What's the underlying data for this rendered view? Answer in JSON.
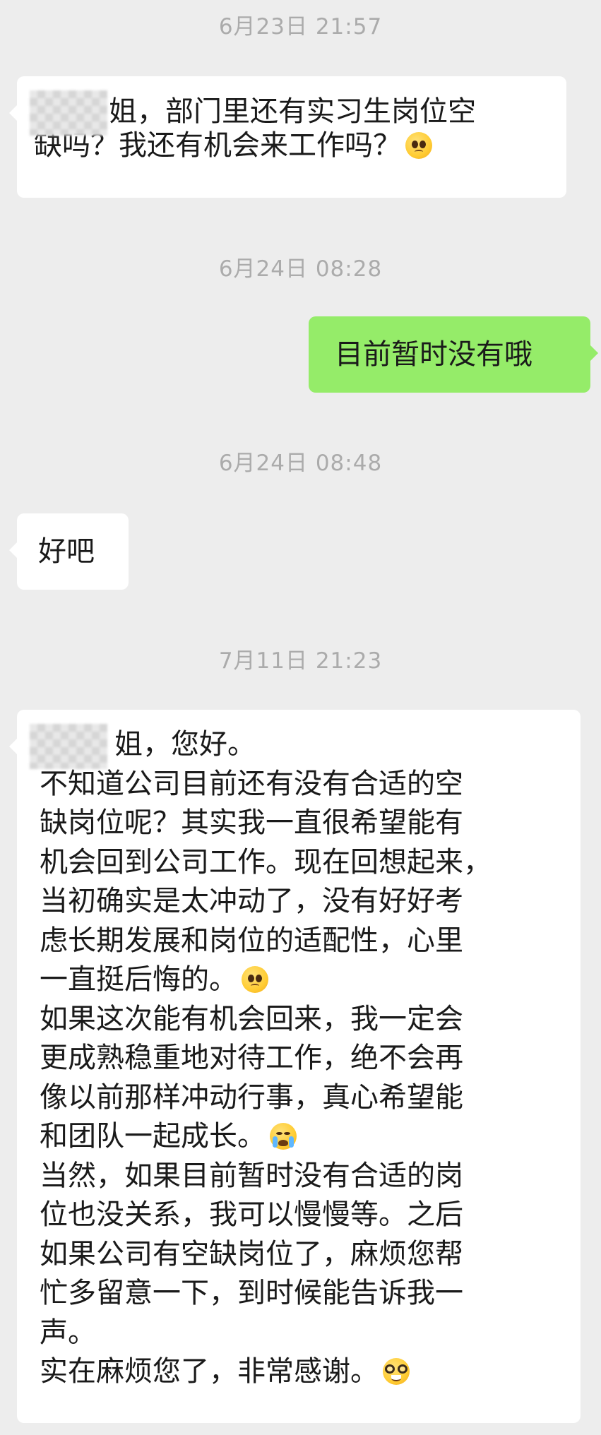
{
  "chat": {
    "timestamps": [
      "6月23日 21:57",
      "6月24日 08:28",
      "6月24日 08:48",
      "7月11日 21:23"
    ],
    "messages": [
      {
        "sender": "other",
        "lines": [
          "姐，部门里还有实习生岗位空",
          "缺吗？我还有机会来工作吗？"
        ],
        "emoji": "pleading-face-emoji"
      },
      {
        "sender": "self",
        "lines": [
          "目前暂时没有哦"
        ]
      },
      {
        "sender": "other",
        "lines": [
          "好吧"
        ]
      },
      {
        "sender": "other",
        "lines": [
          "姐，您好。",
          "不知道公司目前还有没有合适的空",
          "缺岗位呢？其实我一直很希望能有",
          "机会回到公司工作。现在回想起来，",
          "当初确实是太冲动了，没有好好考",
          "虑长期发展和岗位的适配性，心里",
          "一直挺后悔的。",
          "如果这次能有机会回来，我一定会",
          "更成熟稳重地对待工作，绝不会再",
          "像以前那样冲动行事，真心希望能",
          "和团队一起成长。",
          "当然，如果目前暂时没有合适的岗",
          "位也没关系，我可以慢慢等。之后",
          "如果公司有空缺岗位了，麻烦您帮",
          "忙多留意一下，到时候能告诉我一",
          "声。",
          "实在麻烦您了，非常感谢。"
        ],
        "emojis": [
          "pleading-face-emoji",
          "loudly-crying-face-emoji",
          "nerd-face-emoji"
        ]
      }
    ]
  },
  "colors": {
    "background": "#ededed",
    "bubble_other": "#ffffff",
    "bubble_self": "#95ec69",
    "timestamp_text": "#ababab"
  }
}
